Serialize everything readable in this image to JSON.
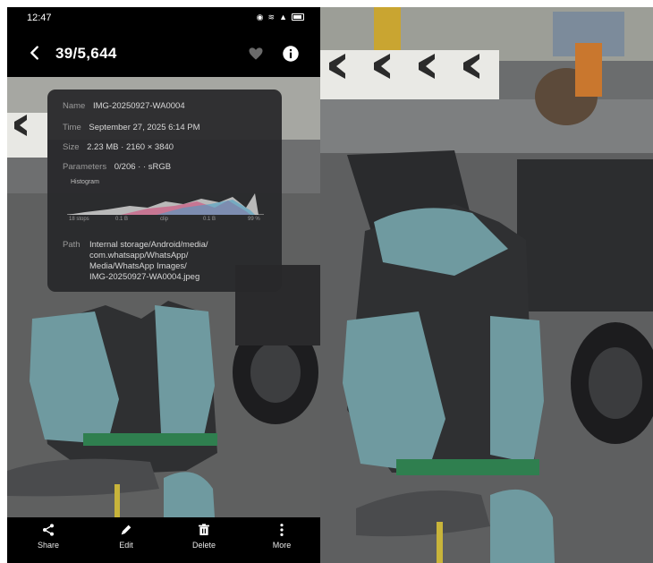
{
  "status_bar": {
    "time": "12:47",
    "icons": [
      "notification-icon",
      "wifi-icon",
      "signal-icon",
      "battery-icon"
    ]
  },
  "app_bar": {
    "counter": "39/5,644",
    "back_icon": "arrow-left-icon",
    "favorite_icon": "heart-icon",
    "info_icon": "info-icon"
  },
  "details": {
    "name_label": "Name",
    "name_value": "IMG-20250927-WA0004",
    "time_label": "Time",
    "time_value": "September 27, 2025 6:14 PM",
    "size_label": "Size",
    "size_value": "2.23 MB · 2160 × 3840",
    "params_label": "Parameters",
    "params_value": "0/206 · · sRGB",
    "histogram_label": "Histogram",
    "histogram_axis": [
      "18 stops",
      "0.1 B",
      "clip",
      "0.1 B",
      "99 %"
    ],
    "path_label": "Path",
    "path_lines": [
      "Internal storage/Android/media/",
      "com.whatsapp/WhatsApp/",
      "Media/WhatsApp Images/",
      "IMG-20250927-WA0004.jpeg"
    ]
  },
  "bottom_bar": {
    "items": [
      {
        "label": "Share",
        "icon": "share-icon"
      },
      {
        "label": "Edit",
        "icon": "edit-icon"
      },
      {
        "label": "Delete",
        "icon": "trash-icon"
      },
      {
        "label": "More",
        "icon": "more-vertical-icon"
      }
    ]
  },
  "colors": {
    "background": "#000000",
    "overlay": "#28282a",
    "bike_body": "#6f9aa0",
    "plate": "#2f7f4f"
  }
}
